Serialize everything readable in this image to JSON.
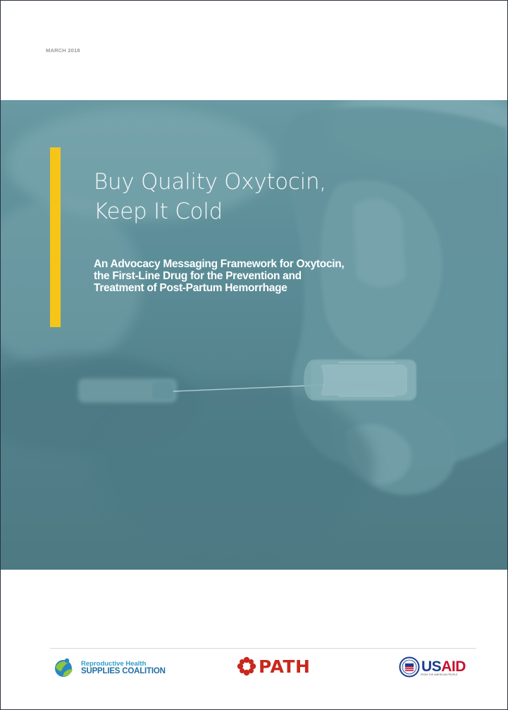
{
  "document": {
    "date": "MARCH 2018",
    "title_line1": "Buy Quality Oxytocin,",
    "title_line2": "Keep It Cold",
    "subtitle_line1": "An Advocacy Messaging Framework  for Oxytocin,",
    "subtitle_line2": "the First-Line Drug for the Prevention and",
    "subtitle_line3": "Treatment of Post-Partum Hemorrhage"
  },
  "colors": {
    "accent_bar": "#f5c518",
    "hero_tint": "#5f8f99"
  },
  "logos": {
    "rhsc": {
      "small": "Reproductive Health",
      "big": "SUPPLIES COALITION",
      "icon": "rhsc-figure-icon"
    },
    "path": {
      "text": "PATH",
      "icon": "path-flower-icon"
    },
    "usaid": {
      "us": "US",
      "aid": "AID",
      "tagline": "FROM THE AMERICAN PEOPLE",
      "icon": "usaid-seal-icon"
    }
  }
}
